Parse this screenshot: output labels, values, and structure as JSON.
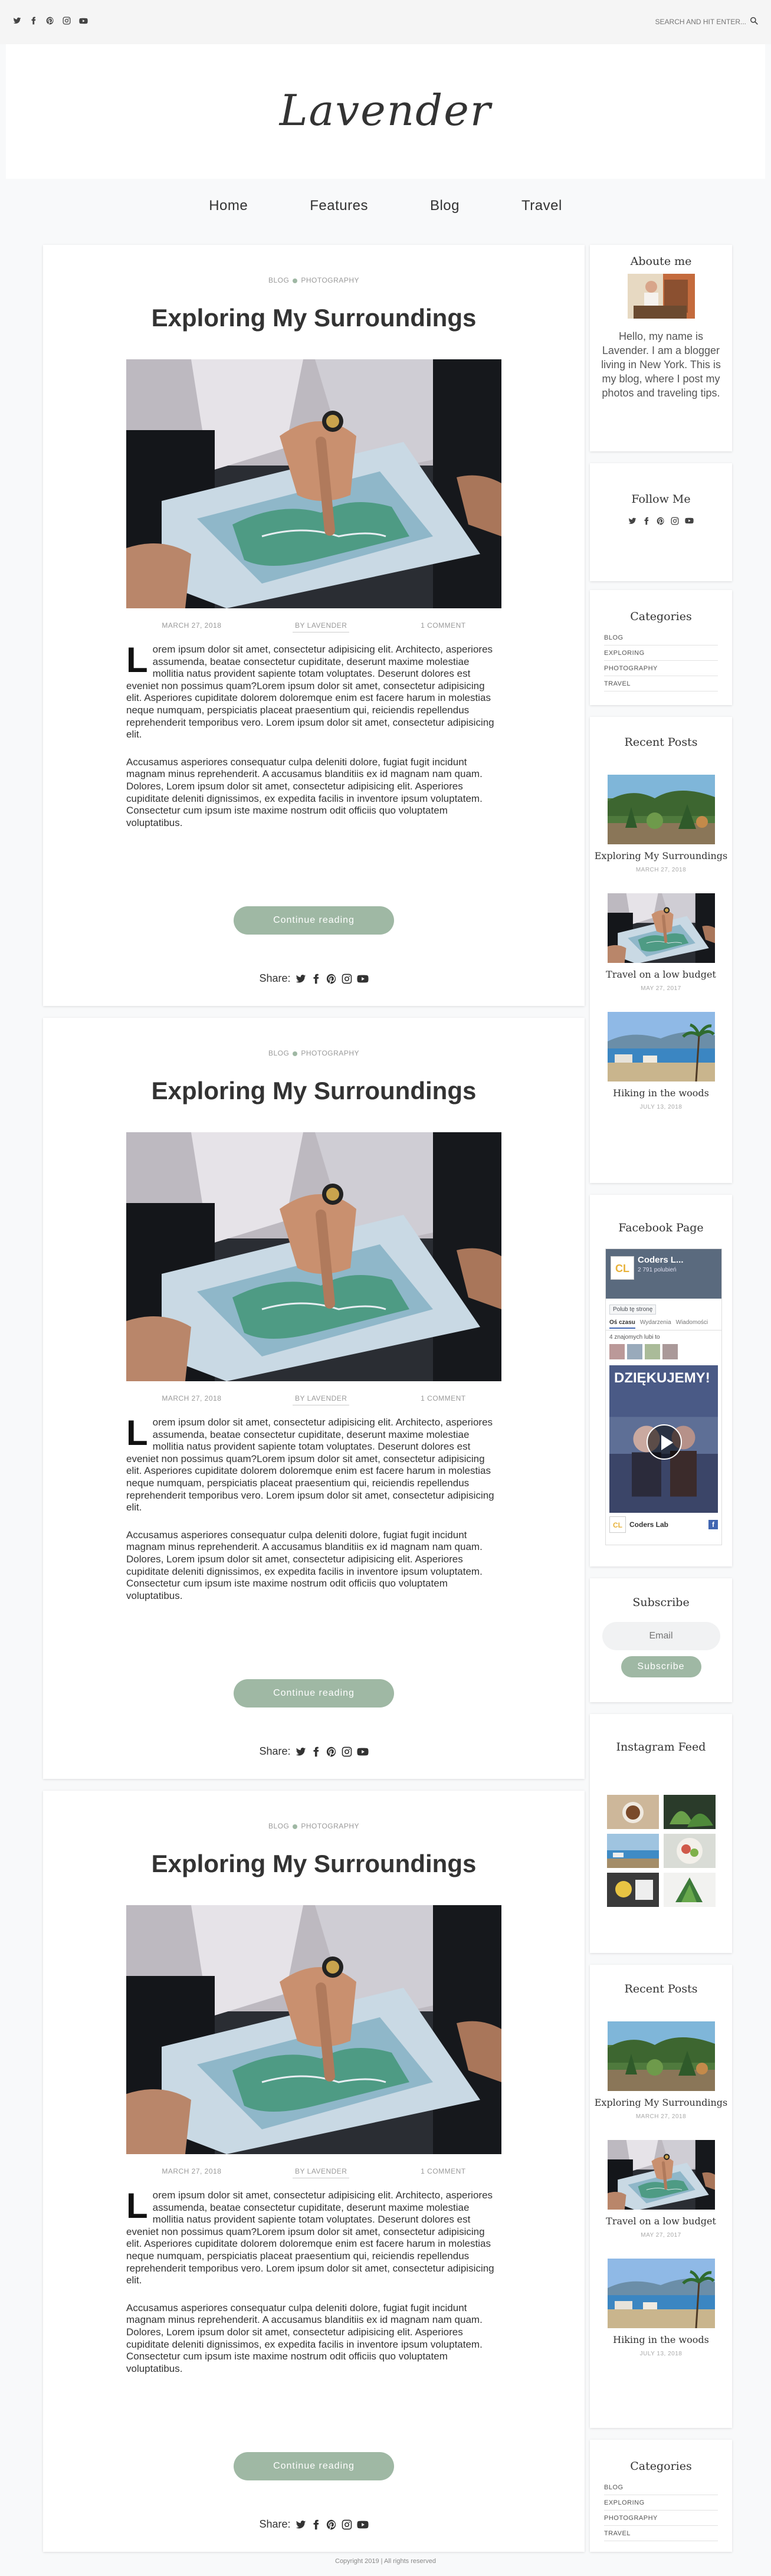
{
  "top": {
    "search_placeholder": "SEARCH AND HIT ENTER..."
  },
  "site": {
    "title": "Lavender"
  },
  "nav": [
    "Home",
    "Features",
    "Blog",
    "Travel"
  ],
  "posts": [
    {
      "category_1": "BLOG",
      "category_2": "PHOTOGRAPHY",
      "title": "Exploring My Surroundings",
      "date": "MARCH 27, 2018",
      "author": "BY LAVENDER",
      "comments": "1 COMMENT",
      "dropcap": "L",
      "para1": "orem ipsum dolor sit amet, consectetur adipisicing elit. Architecto, asperiores assumenda, beatae consectetur cupiditate, deserunt maxime molestiae mollitia natus provident sapiente totam voluptates. Deserunt dolores est eveniet non possimus quam?Lorem ipsum dolor sit amet, consectetur adipisicing elit. Asperiores cupiditate dolorem doloremque enim est facere harum in molestias neque numquam, perspiciatis placeat praesentium qui, reiciendis repellendus reprehenderit temporibus vero. Lorem ipsum dolor sit amet, consectetur adipisicing elit.",
      "para2": "Accusamus asperiores consequatur culpa deleniti dolore, fugiat fugit incidunt magnam minus reprehenderit. A accusamus blanditiis ex id magnam nam quam. Dolores, Lorem ipsum dolor sit amet, consectetur adipisicing elit. Asperiores cupiditate deleniti dignissimos, ex expedita facilis in inventore ipsum voluptatem. Consectetur cum ipsum iste maxime nostrum odit officiis quo voluptatem voluptatibus.",
      "button": "Continue reading",
      "share": "Share:"
    },
    {
      "category_1": "BLOG",
      "category_2": "PHOTOGRAPHY",
      "title": "Exploring My Surroundings",
      "date": "MARCH 27, 2018",
      "author": "BY LAVENDER",
      "comments": "1 COMMENT",
      "dropcap": "L",
      "para1": "orem ipsum dolor sit amet, consectetur adipisicing elit. Architecto, asperiores assumenda, beatae consectetur cupiditate, deserunt maxime molestiae mollitia natus provident sapiente totam voluptates. Deserunt dolores est eveniet non possimus quam?Lorem ipsum dolor sit amet, consectetur adipisicing elit. Asperiores cupiditate dolorem doloremque enim est facere harum in molestias neque numquam, perspiciatis placeat praesentium qui, reiciendis repellendus reprehenderit temporibus vero. Lorem ipsum dolor sit amet, consectetur adipisicing elit.",
      "para2": "Accusamus asperiores consequatur culpa deleniti dolore, fugiat fugit incidunt magnam minus reprehenderit. A accusamus blanditiis ex id magnam nam quam. Dolores, Lorem ipsum dolor sit amet, consectetur adipisicing elit. Asperiores cupiditate deleniti dignissimos, ex expedita facilis in inventore ipsum voluptatem. Consectetur cum ipsum iste maxime nostrum odit officiis quo voluptatem voluptatibus.",
      "button": "Continue reading",
      "share": "Share:"
    },
    {
      "category_1": "BLOG",
      "category_2": "PHOTOGRAPHY",
      "title": "Exploring My Surroundings",
      "date": "MARCH 27, 2018",
      "author": "BY LAVENDER",
      "comments": "1 COMMENT",
      "dropcap": "L",
      "para1": "orem ipsum dolor sit amet, consectetur adipisicing elit. Architecto, asperiores assumenda, beatae consectetur cupiditate, deserunt maxime molestiae mollitia natus provident sapiente totam voluptates. Deserunt dolores est eveniet non possimus quam?Lorem ipsum dolor sit amet, consectetur adipisicing elit. Asperiores cupiditate dolorem doloremque enim est facere harum in molestias neque numquam, perspiciatis placeat praesentium qui, reiciendis repellendus reprehenderit temporibus vero. Lorem ipsum dolor sit amet, consectetur adipisicing elit.",
      "para2": "Accusamus asperiores consequatur culpa deleniti dolore, fugiat fugit incidunt magnam minus reprehenderit. A accusamus blanditiis ex id magnam nam quam. Dolores, Lorem ipsum dolor sit amet, consectetur adipisicing elit. Asperiores cupiditate deleniti dignissimos, ex expedita facilis in inventore ipsum voluptatem. Consectetur cum ipsum iste maxime nostrum odit officiis quo voluptatem voluptatibus.",
      "button": "Continue reading",
      "share": "Share:"
    }
  ],
  "sidebar": {
    "about": {
      "title": "Aboute me",
      "text": "Hello, my name is Lavender. I am a blogger living in New York. This is my blog, where I post my photos and traveling tips."
    },
    "follow": {
      "title": "Follow Me"
    },
    "categories": {
      "title": "Categories",
      "items": [
        "BLOG",
        "EXPLORING",
        "PHOTOGRAPHY",
        "TRAVEL"
      ]
    },
    "recent": {
      "title": "Recent Posts",
      "items": [
        {
          "title": "Exploring My Surroundings",
          "date": "MARCH 27, 2018"
        },
        {
          "title": "Travel on a low budget",
          "date": "MAY 27, 2017"
        },
        {
          "title": "Hiking in the woods",
          "date": "JULY 13, 2018"
        }
      ]
    },
    "facebook": {
      "title": "Facebook Page",
      "page_name": "Coders L...",
      "likes": "2 791 polubień",
      "like_btn": "Polub tę stronę",
      "tab1": "Oś czasu",
      "tab2": "Wydarzenia",
      "tab3": "Wiadomości",
      "friends": "4 znajomych lubi to",
      "banner_text": "DZIĘKUJEMY!",
      "footer_name": "Coders Lab"
    },
    "subscribe": {
      "title": "Subscribe",
      "placeholder": "Email",
      "button": "Subscribe"
    },
    "instagram": {
      "title": "Instagram Feed"
    },
    "recent2": {
      "title": "Recent Posts",
      "items": [
        {
          "title": "Exploring My Surroundings",
          "date": "MARCH 27, 2018"
        },
        {
          "title": "Travel on a low budget",
          "date": "MAY 27, 2017"
        },
        {
          "title": "Hiking in the woods",
          "date": "JULY 13, 2018"
        }
      ]
    },
    "categories2": {
      "title": "Categories",
      "items": [
        "BLOG",
        "EXPLORING",
        "PHOTOGRAPHY",
        "TRAVEL"
      ]
    }
  },
  "footer": {
    "text": "Copyright 2019 | All rights reserved"
  },
  "colors": {
    "accent": "#9fb8a4",
    "page_bg": "#f8f9fa",
    "card_bg": "#ffffff"
  }
}
